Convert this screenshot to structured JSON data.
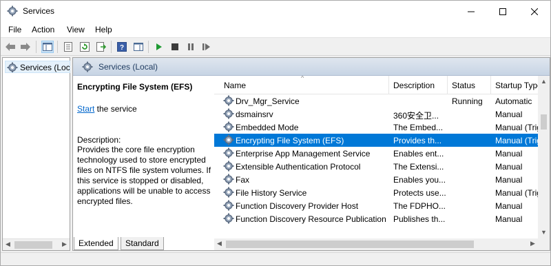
{
  "window": {
    "title": "Services"
  },
  "menu": {
    "items": [
      "File",
      "Action",
      "View",
      "Help"
    ]
  },
  "toolbar": {
    "icons": [
      "back-icon",
      "forward-icon",
      "show-hide-tree-icon",
      "properties-icon",
      "refresh-icon",
      "export-list-icon",
      "help-icon",
      "show-hide-action-pane-icon",
      "start-service-icon",
      "stop-service-icon",
      "pause-service-icon",
      "restart-service-icon"
    ]
  },
  "tree": {
    "item_label": "Services (Loca"
  },
  "pane": {
    "header_label": "Services (Local)"
  },
  "details": {
    "service_name": "Encrypting File System (EFS)",
    "start_link": "Start",
    "start_suffix": " the service",
    "description_label": "Description:",
    "description_text": "Provides the core file encryption technology used to store encrypted files on NTFS file system volumes. If this service is stopped or disabled, applications will be unable to access encrypted files."
  },
  "list": {
    "columns": [
      "Name",
      "Description",
      "Status",
      "Startup Type"
    ],
    "rows": [
      {
        "name": "Drv_Mgr_Service",
        "description": "",
        "status": "Running",
        "startup": "Automatic"
      },
      {
        "name": "dsmainsrv",
        "description": "360安全卫...",
        "status": "",
        "startup": "Manual"
      },
      {
        "name": "Embedded Mode",
        "description": "The Embed...",
        "status": "",
        "startup": "Manual (Trig"
      },
      {
        "name": "Encrypting File System (EFS)",
        "description": "Provides th...",
        "status": "",
        "startup": "Manual (Trig",
        "selected": true
      },
      {
        "name": "Enterprise App Management Service",
        "description": "Enables ent...",
        "status": "",
        "startup": "Manual"
      },
      {
        "name": "Extensible Authentication Protocol",
        "description": "The Extensi...",
        "status": "",
        "startup": "Manual"
      },
      {
        "name": "Fax",
        "description": "Enables you...",
        "status": "",
        "startup": "Manual"
      },
      {
        "name": "File History Service",
        "description": "Protects use...",
        "status": "",
        "startup": "Manual (Trig"
      },
      {
        "name": "Function Discovery Provider Host",
        "description": "The FDPHO...",
        "status": "",
        "startup": "Manual"
      },
      {
        "name": "Function Discovery Resource Publication",
        "description": "Publishes th...",
        "status": "",
        "startup": "Manual"
      }
    ]
  },
  "tabs": {
    "extended": "Extended",
    "standard": "Standard"
  },
  "colors": {
    "selection": "#0078d7",
    "link": "#0066cc"
  }
}
